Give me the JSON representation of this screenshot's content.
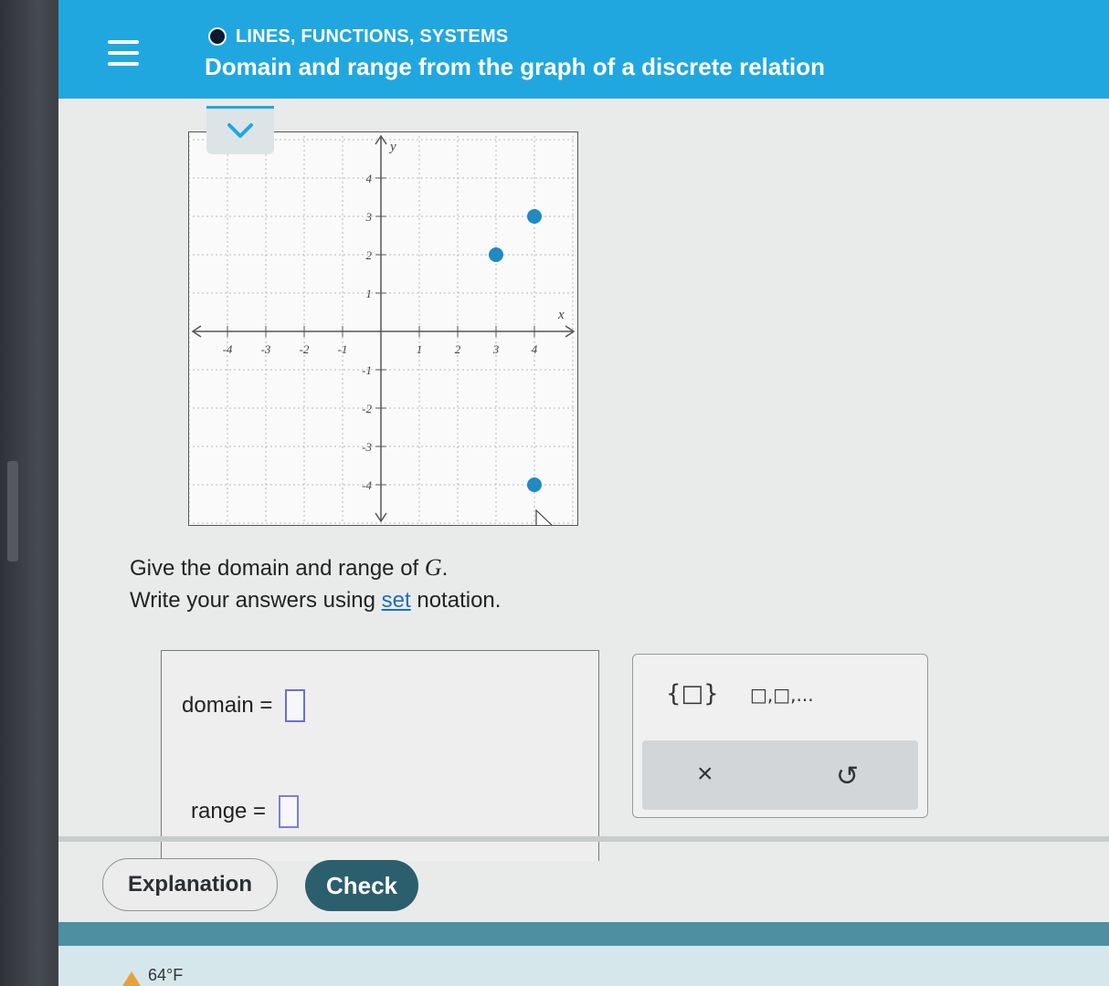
{
  "header": {
    "topic": "LINES, FUNCTIONS, SYSTEMS",
    "title": "Domain and range from the graph of a discrete relation"
  },
  "graph": {
    "axis_labels": {
      "x": "x",
      "y": "y"
    },
    "x_ticks": [
      "-4",
      "-3",
      "-2",
      "-1",
      "1",
      "2",
      "3",
      "4"
    ],
    "y_ticks": [
      "4",
      "3",
      "2",
      "1",
      "-1",
      "-2",
      "-3",
      "-4"
    ]
  },
  "chart_data": {
    "type": "scatter",
    "x_range": [
      -5,
      5
    ],
    "y_range": [
      -5,
      5
    ],
    "grid": true,
    "points": [
      {
        "x": 3,
        "y": 2
      },
      {
        "x": 4,
        "y": 3
      },
      {
        "x": 4,
        "y": -4
      }
    ],
    "point_color": "#1f8ac4"
  },
  "prompt": {
    "line1_prefix": "Give the domain and range of ",
    "relation": "G",
    "line1_suffix": ".",
    "line2_prefix": "Write your answers using ",
    "line2_link": "set",
    "line2_suffix": " notation."
  },
  "answers": {
    "domain_label": "domain =",
    "range_label": "range ="
  },
  "palette": {
    "set_symbol": "{□}",
    "list_symbol": "□,□,...",
    "clear_symbol": "×",
    "undo_symbol": "↺"
  },
  "buttons": {
    "explanation": "Explanation",
    "check": "Check"
  },
  "taskbar": {
    "weather": "64°F"
  },
  "colors": {
    "header_blue": "#21a7df",
    "check_button": "#2c5f6e",
    "point": "#1f8ac4"
  }
}
